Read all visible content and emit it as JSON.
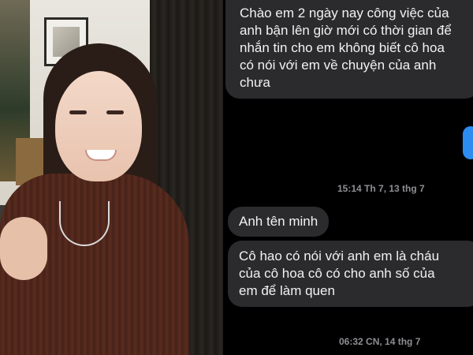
{
  "chat": {
    "messages": [
      {
        "lines": [
          "Chào em 2 ngày nay công việc của",
          "anh bận lên giờ mới có thời gian để",
          "nhắn tin cho em không biết cô hoa",
          "có nói với em về chuyện của anh",
          "chưa"
        ]
      },
      {
        "timestamp": "15:14 Th 7, 13 thg 7"
      },
      {
        "lines": [
          "Anh tên minh"
        ]
      },
      {
        "lines": [
          "Cô hao có nói với anh em là cháu",
          "của cô hoa cô có cho anh số của",
          "em để làm quen"
        ]
      },
      {
        "timestamp": "06:32 CN, 14 thg 7"
      }
    ]
  },
  "colors": {
    "incoming_bubble": "#2b2b2e",
    "outgoing_bubble": "#2d8cf0",
    "timestamp": "#8e8e93",
    "background": "#000000"
  }
}
